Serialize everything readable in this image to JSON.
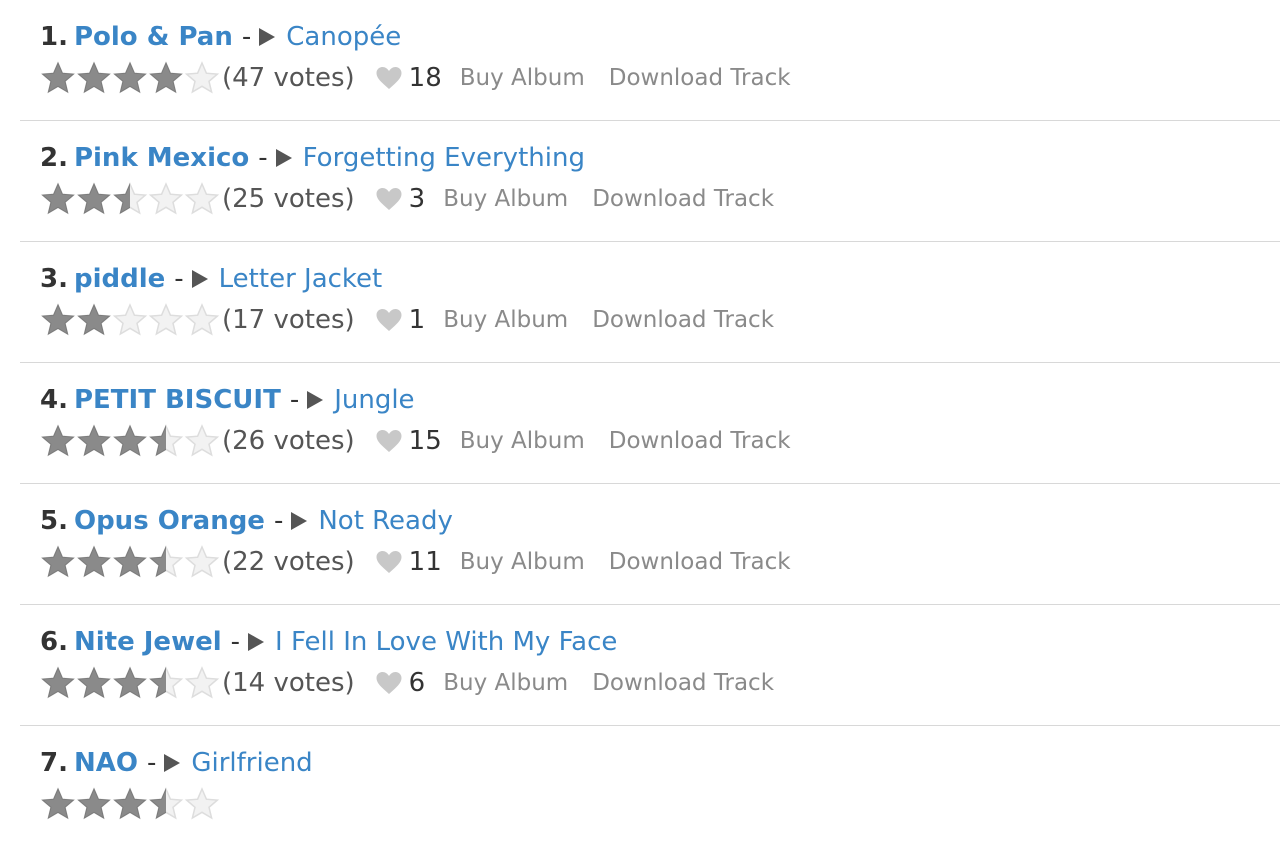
{
  "colors": {
    "link_blue": "#3a85c6",
    "star_filled": "#8a8a8a",
    "star_empty": "#dddddd",
    "heart": "#c8c8c8",
    "action_gray": "#8a8a8a",
    "divider": "#d8d8d8"
  },
  "icons": {
    "play": "play-icon",
    "star": "star-icon",
    "heart": "heart-icon"
  },
  "entries": [
    {
      "rank": "1.",
      "artist": "Polo & Pan",
      "sep": "-",
      "track": "Canopée",
      "rating": 4,
      "votes": "(47 votes)",
      "likes": "18",
      "buy": "Buy Album",
      "download": "Download Track"
    },
    {
      "rank": "2.",
      "artist": "Pink Mexico",
      "sep": "-",
      "track": "Forgetting Everything",
      "rating": 2.5,
      "votes": "(25 votes)",
      "likes": "3",
      "buy": "Buy Album",
      "download": "Download Track"
    },
    {
      "rank": "3.",
      "artist": "piddle",
      "sep": "-",
      "track": "Letter Jacket",
      "rating": 2,
      "votes": "(17 votes)",
      "likes": "1",
      "buy": "Buy Album",
      "download": "Download Track"
    },
    {
      "rank": "4.",
      "artist": "PETIT BISCUIT",
      "sep": "-",
      "track": "Jungle",
      "rating": 3.5,
      "votes": "(26 votes)",
      "likes": "15",
      "buy": "Buy Album",
      "download": "Download Track"
    },
    {
      "rank": "5.",
      "artist": "Opus Orange",
      "sep": "-",
      "track": "Not Ready",
      "rating": 3.5,
      "votes": "(22 votes)",
      "likes": "11",
      "buy": "Buy Album",
      "download": "Download Track"
    },
    {
      "rank": "6.",
      "artist": "Nite Jewel",
      "sep": "-",
      "track": "I Fell In Love With My Face",
      "rating": 3.5,
      "votes": "(14 votes)",
      "likes": "6",
      "buy": "Buy Album",
      "download": "Download Track"
    },
    {
      "rank": "7.",
      "artist": "NAO",
      "sep": "-",
      "track": "Girlfriend",
      "rating": 3.5,
      "votes": "",
      "likes": "",
      "buy": "",
      "download": ""
    }
  ]
}
